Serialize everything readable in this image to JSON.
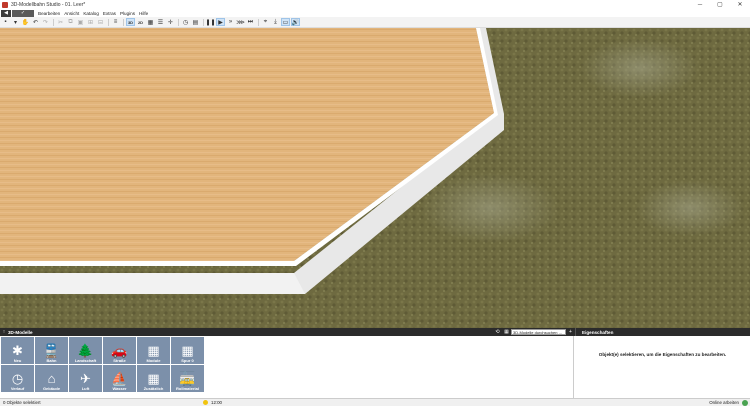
{
  "window": {
    "title": "3D-Modellbahn Studio - 01. Leer*",
    "minimize_glyph": "─",
    "maximize_glyph": "▢",
    "close_glyph": "✕"
  },
  "menu": {
    "back_glyph": "◀",
    "forward_glyph": "✓",
    "items": [
      "Bearbeiten",
      "Ansicht",
      "Katalog",
      "Extras",
      "Plugins",
      "Hilfe"
    ]
  },
  "toolbar": {
    "mode_3d": "3D",
    "mode_2d": "2D"
  },
  "panels": {
    "models_title": "3D-Modelle",
    "search_placeholder": "3D-Modelle durchsuchen ...",
    "properties_title": "Eigenschaften",
    "properties_hint": "Objekt(e) selektieren, um die Eigenschaften zu bearbeiten."
  },
  "catalog": {
    "tiles": [
      {
        "label": "Neu",
        "icon": "snowflake-icon",
        "glyph": "✱"
      },
      {
        "label": "Bahn",
        "icon": "train-icon",
        "glyph": "🚆"
      },
      {
        "label": "Landschaft",
        "icon": "tree-icon",
        "glyph": "🌲"
      },
      {
        "label": "Straße",
        "icon": "car-icon",
        "glyph": "🚗"
      },
      {
        "label": "Module",
        "icon": "grid-icon",
        "glyph": "▦"
      },
      {
        "label": "Spur 0",
        "icon": "grid-icon",
        "glyph": "▦"
      },
      {
        "label": "Verlauf",
        "icon": "clock-icon",
        "glyph": "◷"
      },
      {
        "label": "Gebäude",
        "icon": "house-icon",
        "glyph": "⌂"
      },
      {
        "label": "Luft",
        "icon": "plane-icon",
        "glyph": "✈"
      },
      {
        "label": "Wasser",
        "icon": "sailboat-icon",
        "glyph": "⛵"
      },
      {
        "label": "Zusätzlich",
        "icon": "grid-icon",
        "glyph": "▦"
      },
      {
        "label": "Rollmaterial",
        "icon": "tram-icon",
        "glyph": "🚋"
      }
    ]
  },
  "status": {
    "selection": "0 Objekte selektiert",
    "time": "12:00",
    "online": "Online arbeiten"
  },
  "colors": {
    "catalog_tile": "#7c90aa",
    "panel_header": "#2b2b2b",
    "table_wood": "#e0b47a",
    "ground_grass": "#6e6a40"
  }
}
